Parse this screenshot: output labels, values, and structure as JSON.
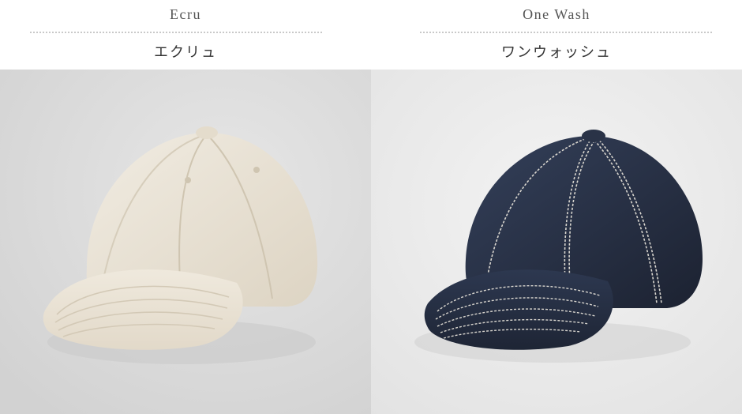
{
  "products": [
    {
      "name_en": "Ecru",
      "name_ja": "エクリュ",
      "image": "ecru-cap-photo"
    },
    {
      "name_en": "One Wash",
      "name_ja": "ワンウォッシュ",
      "image": "one-wash-cap-photo"
    }
  ],
  "colors": {
    "ecru_cap": "#e9e2d4",
    "denim_cap": "#27303f",
    "stitch": "#d9d6cf",
    "background_left": "#dcdcdc",
    "background_right": "#ededed"
  }
}
